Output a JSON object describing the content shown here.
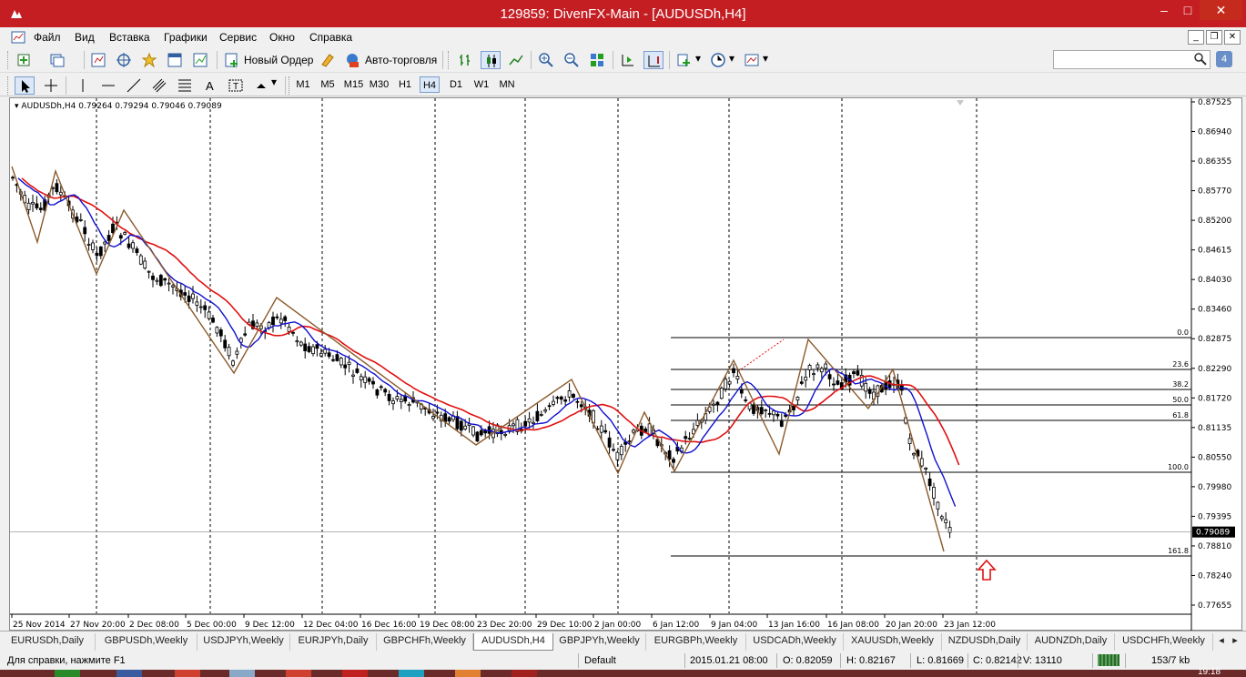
{
  "window": {
    "title": "129859: DivenFX-Main - [AUDUSDh,H4]",
    "controls": [
      "–",
      "□",
      "✕"
    ]
  },
  "menu": [
    "Файл",
    "Вид",
    "Вставка",
    "Графики",
    "Сервис",
    "Окно",
    "Справка"
  ],
  "toolbar": {
    "new_order": "Новый Ордер",
    "auto_trading": "Авто-торговля"
  },
  "timeframes": [
    "M1",
    "M5",
    "M15",
    "M30",
    "H1",
    "H4",
    "D1",
    "W1",
    "MN"
  ],
  "selected_timeframe": "H4",
  "chart": {
    "header": "AUDUSDh,H4  0.79264 0.79294 0.79046 0.79089",
    "current_price": "0.79089",
    "price_labels": [
      "0.87525",
      "0.86940",
      "0.86355",
      "0.85770",
      "0.85200",
      "0.84615",
      "0.84030",
      "0.83460",
      "0.82875",
      "0.82290",
      "0.81720",
      "0.81135",
      "0.80550",
      "0.79980",
      "0.79395",
      "0.78810",
      "0.78240",
      "0.77655"
    ],
    "date_labels": [
      "25 Nov 2014",
      "27 Nov 20:00",
      "2 Dec 08:00",
      "5 Dec 00:00",
      "9 Dec 12:00",
      "12 Dec 04:00",
      "16 Dec 16:00",
      "19 Dec 08:00",
      "23 Dec 20:00",
      "29 Dec 10:00",
      "2 Jan 00:00",
      "6 Jan 12:00",
      "9 Jan 04:00",
      "13 Jan 16:00",
      "16 Jan 08:00",
      "20 Jan 20:00",
      "23 Jan 12:00"
    ],
    "fibo_levels": [
      "0.0",
      "23.6",
      "38.2",
      "50.0",
      "61.8",
      "100.0",
      "161.8"
    ],
    "colors": {
      "candles": "#000000",
      "ma_fast": "#1010d0",
      "ma_slow": "#e01010",
      "zigzag": "#8b5a2b",
      "fibo": "#000000",
      "arrow": "#e01010",
      "current_price_bg": "#000000"
    }
  },
  "chart_tabs": [
    "EURUSDh,Daily",
    "GBPUSDh,Weekly",
    "USDJPYh,Weekly",
    "EURJPYh,Daily",
    "GBPCHFh,Weekly",
    "AUDUSDh,H4",
    "GBPJPYh,Weekly",
    "EURGBPh,Weekly",
    "USDCADh,Weekly",
    "XAUUSDh,Weekly",
    "NZDUSDh,Daily",
    "AUDNZDh,Daily",
    "USDCHFh,Weekly"
  ],
  "active_tab": "AUDUSDh,H4",
  "status": {
    "help": "Для справки, нажмите F1",
    "profile": "Default",
    "datetime": "2015.01.21 08:00",
    "open": "O: 0.82059",
    "high": "H: 0.82167",
    "low": "L: 0.81669",
    "close": "C: 0.82142",
    "volume": "V: 13110",
    "traffic": "153/7 kb"
  },
  "taskbar": {
    "clock": "19:18"
  }
}
